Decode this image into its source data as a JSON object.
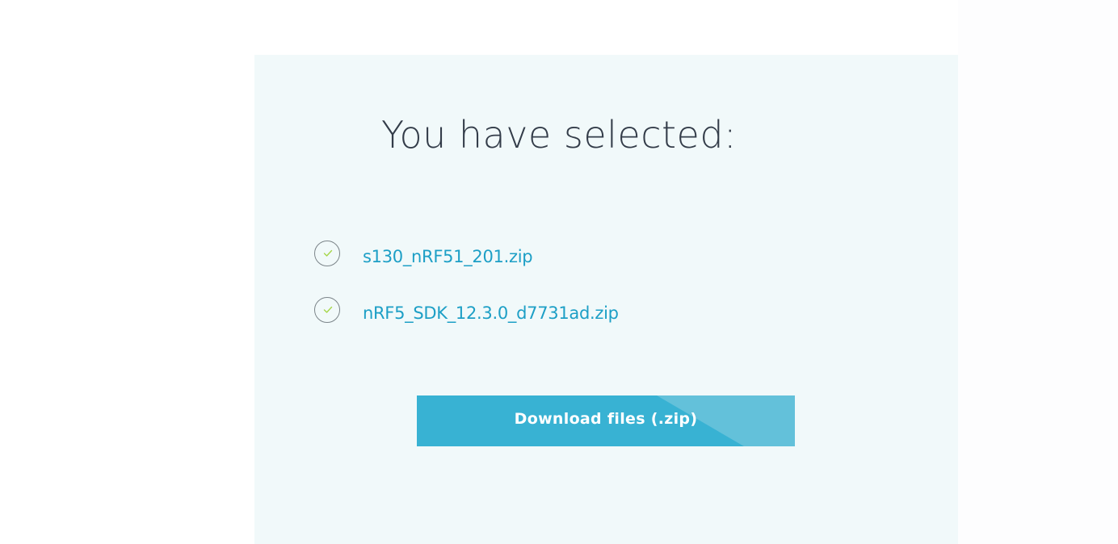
{
  "panel": {
    "title": "You have selected:"
  },
  "selected_files": [
    {
      "name": "s130_nRF51_201.zip",
      "checked": true
    },
    {
      "name": "nRF5_SDK_12.3.0_d7731ad.zip",
      "checked": true
    }
  ],
  "download_button": {
    "label": "Download files (.zip)"
  },
  "icons": {
    "check": "check-icon"
  },
  "colors": {
    "panel_background": "#f1f9fa",
    "title_text": "#333c49",
    "file_link": "#1d9fc6",
    "check_mark": "#a6d64a",
    "button": "#38b2d3",
    "button_accent": "#63c1da"
  }
}
